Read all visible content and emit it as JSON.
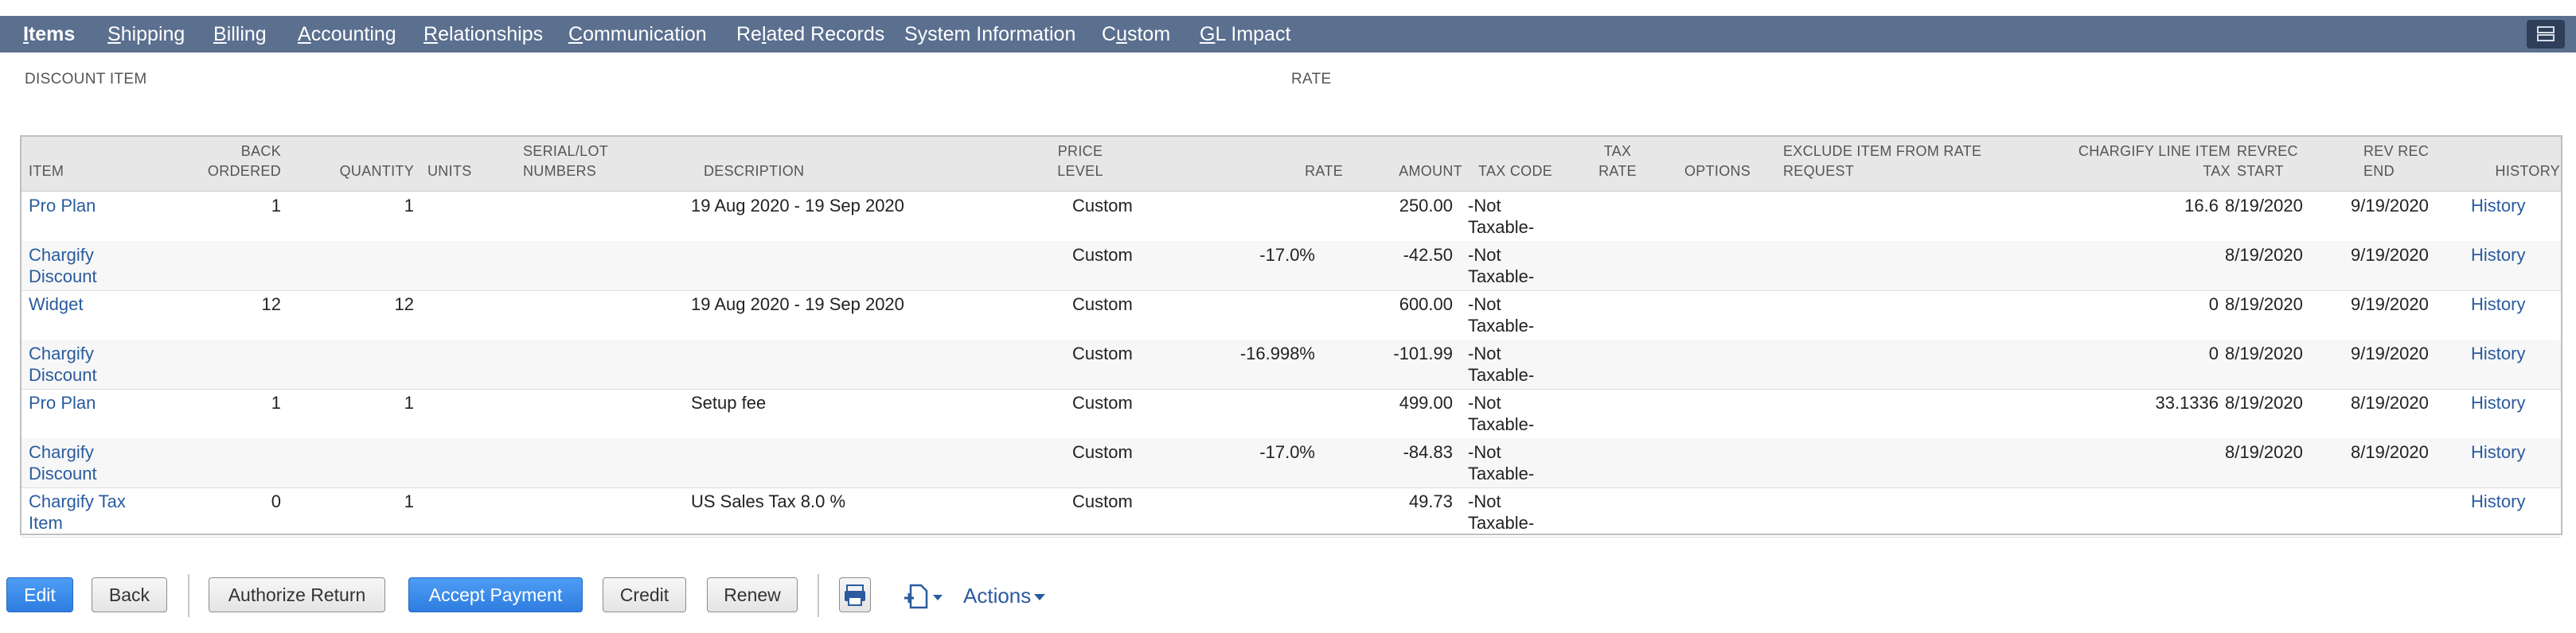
{
  "tabs": [
    {
      "id": "items",
      "pre": "",
      "ul": "I",
      "post": "tems",
      "active": true
    },
    {
      "id": "shipping",
      "pre": "",
      "ul": "S",
      "post": "hipping",
      "active": false
    },
    {
      "id": "billing",
      "pre": "",
      "ul": "B",
      "post": "illing",
      "active": false
    },
    {
      "id": "accounting",
      "pre": "",
      "ul": "A",
      "post": "ccounting",
      "active": false
    },
    {
      "id": "relationships",
      "pre": "",
      "ul": "R",
      "post": "elationships",
      "active": false
    },
    {
      "id": "communication",
      "pre": "",
      "ul": "C",
      "post": "ommunication",
      "active": false
    },
    {
      "id": "related-records",
      "pre": "Re",
      "ul": "l",
      "post": "ated Records",
      "active": false
    },
    {
      "id": "system-information",
      "pre": "System Information",
      "ul": "",
      "post": "",
      "active": false
    },
    {
      "id": "custom",
      "pre": "C",
      "ul": "u",
      "post": "stom",
      "active": false
    },
    {
      "id": "gl-impact",
      "pre": "",
      "ul": "G",
      "post": "L Impact",
      "active": false
    }
  ],
  "discount_item_label": "DISCOUNT ITEM",
  "rate_label": "RATE",
  "columns": {
    "item": [
      "ITEM"
    ],
    "back_ordered": [
      "BACK",
      "ORDERED"
    ],
    "quantity": [
      "QUANTITY"
    ],
    "units": [
      "UNITS"
    ],
    "serial": [
      "SERIAL/LOT",
      "NUMBERS"
    ],
    "description": [
      "DESCRIPTION"
    ],
    "price_level": [
      "PRICE",
      "LEVEL"
    ],
    "rate": [
      "RATE"
    ],
    "amount": [
      "AMOUNT"
    ],
    "tax_code": [
      "TAX CODE"
    ],
    "tax_rate": [
      "TAX",
      "RATE"
    ],
    "options": [
      "OPTIONS"
    ],
    "exclude": [
      "EXCLUDE ITEM FROM RATE",
      "REQUEST"
    ],
    "chargify_tax": [
      "CHARGIFY LINE ITEM",
      "TAX"
    ],
    "revrec_start": [
      "REVREC",
      "START"
    ],
    "revrec_end": [
      "REV REC",
      "END"
    ],
    "history": [
      "HISTORY"
    ]
  },
  "rows": [
    {
      "item": [
        "Pro Plan"
      ],
      "back_ordered": "1",
      "quantity": "1",
      "description": "19 Aug 2020 - 19 Sep 2020",
      "price_level": "Custom",
      "rate": "",
      "amount": "250.00",
      "tax_code": [
        "-Not",
        "Taxable-"
      ],
      "chargify_tax": "16.6",
      "revrec_start": "8/19/2020",
      "revrec_end": "9/19/2020",
      "history": "History"
    },
    {
      "item": [
        "Chargify",
        "Discount"
      ],
      "back_ordered": "",
      "quantity": "",
      "description": "",
      "price_level": "Custom",
      "rate": "-17.0%",
      "amount": "-42.50",
      "tax_code": [
        "-Not",
        "Taxable-"
      ],
      "chargify_tax": "",
      "revrec_start": "8/19/2020",
      "revrec_end": "9/19/2020",
      "history": "History"
    },
    {
      "item": [
        "Widget"
      ],
      "back_ordered": "12",
      "quantity": "12",
      "description": "19 Aug 2020 - 19 Sep 2020",
      "price_level": "Custom",
      "rate": "",
      "amount": "600.00",
      "tax_code": [
        "-Not",
        "Taxable-"
      ],
      "chargify_tax": "0",
      "revrec_start": "8/19/2020",
      "revrec_end": "9/19/2020",
      "history": "History"
    },
    {
      "item": [
        "Chargify",
        "Discount"
      ],
      "back_ordered": "",
      "quantity": "",
      "description": "",
      "price_level": "Custom",
      "rate": "-16.998%",
      "amount": "-101.99",
      "tax_code": [
        "-Not",
        "Taxable-"
      ],
      "chargify_tax": "0",
      "revrec_start": "8/19/2020",
      "revrec_end": "9/19/2020",
      "history": "History"
    },
    {
      "item": [
        "Pro Plan"
      ],
      "back_ordered": "1",
      "quantity": "1",
      "description": "Setup fee",
      "price_level": "Custom",
      "rate": "",
      "amount": "499.00",
      "tax_code": [
        "-Not",
        "Taxable-"
      ],
      "chargify_tax": "33.1336",
      "revrec_start": "8/19/2020",
      "revrec_end": "8/19/2020",
      "history": "History"
    },
    {
      "item": [
        "Chargify",
        "Discount"
      ],
      "back_ordered": "",
      "quantity": "",
      "description": "",
      "price_level": "Custom",
      "rate": "-17.0%",
      "amount": "-84.83",
      "tax_code": [
        "-Not",
        "Taxable-"
      ],
      "chargify_tax": "",
      "revrec_start": "8/19/2020",
      "revrec_end": "8/19/2020",
      "history": "History"
    },
    {
      "item": [
        "Chargify Tax",
        "Item"
      ],
      "back_ordered": "0",
      "quantity": "1",
      "description": "US Sales Tax 8.0 %",
      "price_level": "Custom",
      "rate": "",
      "amount": "49.73",
      "tax_code": [
        "-Not",
        "Taxable-"
      ],
      "chargify_tax": "",
      "revrec_start": "",
      "revrec_end": "",
      "history": "History"
    }
  ],
  "buttons": {
    "edit": "Edit",
    "back": "Back",
    "authorize_return": "Authorize Return",
    "accept_payment": "Accept Payment",
    "credit": "Credit",
    "renew": "Renew",
    "actions": "Actions"
  },
  "icons": {
    "tab_bar_toggle": "layout-toggle-icon",
    "print": "print-icon",
    "new_document": "new-document-icon"
  },
  "colors": {
    "tab_bar": "#5b6f8f",
    "link": "#2a5b9e",
    "primary_button": "#2e7de0"
  }
}
